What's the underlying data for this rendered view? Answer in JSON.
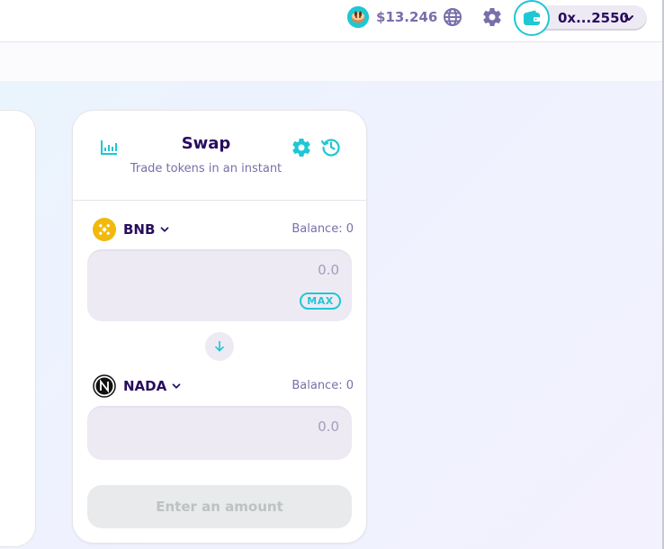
{
  "header": {
    "cake_price": "$13.246",
    "cake_icon": "pancake-icon",
    "language_icon": "globe-icon",
    "settings_icon": "gear-icon",
    "wallet_icon": "wallet-icon",
    "wallet_address": "0x...2550"
  },
  "swap": {
    "title": "Swap",
    "subtitle": "Trade tokens in an instant",
    "from": {
      "symbol": "BNB",
      "balance": "Balance: 0",
      "placeholder": "0.0",
      "max_label": "MAX"
    },
    "to": {
      "symbol": "NADA",
      "balance": "Balance: 0",
      "placeholder": "0.0"
    },
    "action_label": "Enter an amount"
  },
  "colors": {
    "primary": "#1fc7d4",
    "text": "#280d5f",
    "subtext": "#7a6eaa",
    "input_bg": "#eeeaf4",
    "bnb": "#f0b90b"
  }
}
